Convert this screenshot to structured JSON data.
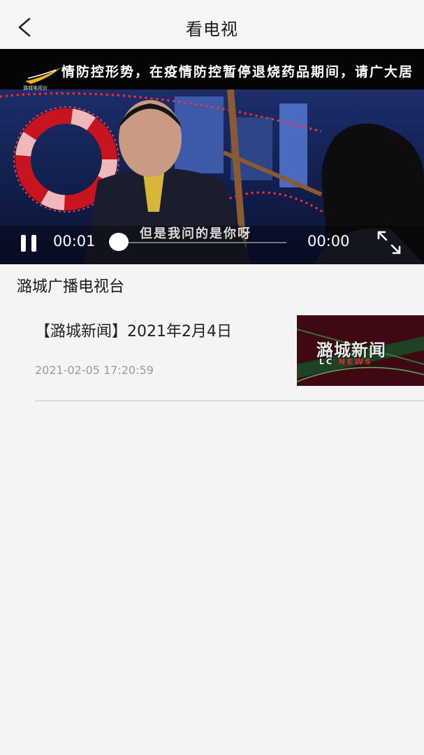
{
  "header": {
    "title": "看电视",
    "back_icon": "chevron-left-icon"
  },
  "player": {
    "ticker": "情防控形势，在疫情防控暂停退烧药品期间，请广大居",
    "logo_text": "潞城电视台",
    "subtitle": "但是我问的是你呀",
    "current_time": "00:01",
    "total_time": "00:00",
    "progress": 0.0,
    "play_state_icon": "pause-icon",
    "fullscreen_icon": "fullscreen-icon"
  },
  "channel": {
    "name": "潞城广播电视台"
  },
  "news": [
    {
      "title": "【潞城新闻】2021年2月4日",
      "time": "2021-02-05 17:20:59",
      "thumb_title": "潞城新闻",
      "thumb_sub_prefix": "LC ",
      "thumb_sub_accent": "NEWS"
    }
  ],
  "colors": {
    "accent_red": "#e12a2a",
    "text_dark": "#222222",
    "text_muted": "#9a9a9a"
  }
}
